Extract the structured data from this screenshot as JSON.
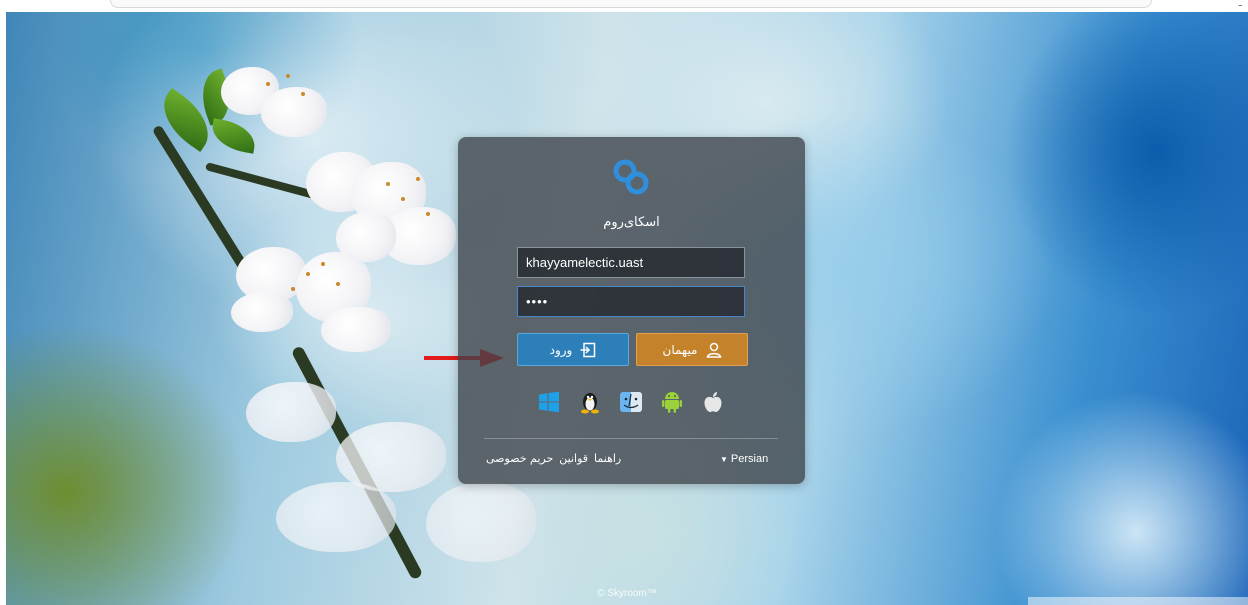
{
  "brand": {
    "app_name": "اسکای‌روم",
    "logo_icon": "skyroom-logo-icon",
    "logo_color": "#2f8fdd"
  },
  "login_form": {
    "username_value": "khayyamelectic.uast",
    "password_value": "••••",
    "login_button_label": "ورود",
    "guest_button_label": "میهمان",
    "login_button_color": "#2c7fb8",
    "guest_button_color": "#c4822b"
  },
  "platforms": [
    {
      "name": "windows-icon"
    },
    {
      "name": "linux-icon"
    },
    {
      "name": "macos-finder-icon"
    },
    {
      "name": "android-icon"
    },
    {
      "name": "apple-icon"
    }
  ],
  "footer": {
    "language": "Persian",
    "links": [
      "راهنما",
      "قوانین",
      "حریم خصوصی"
    ]
  },
  "copyright": "© Skyroom™",
  "annotation": {
    "arrow_color": "#e31b1b"
  }
}
